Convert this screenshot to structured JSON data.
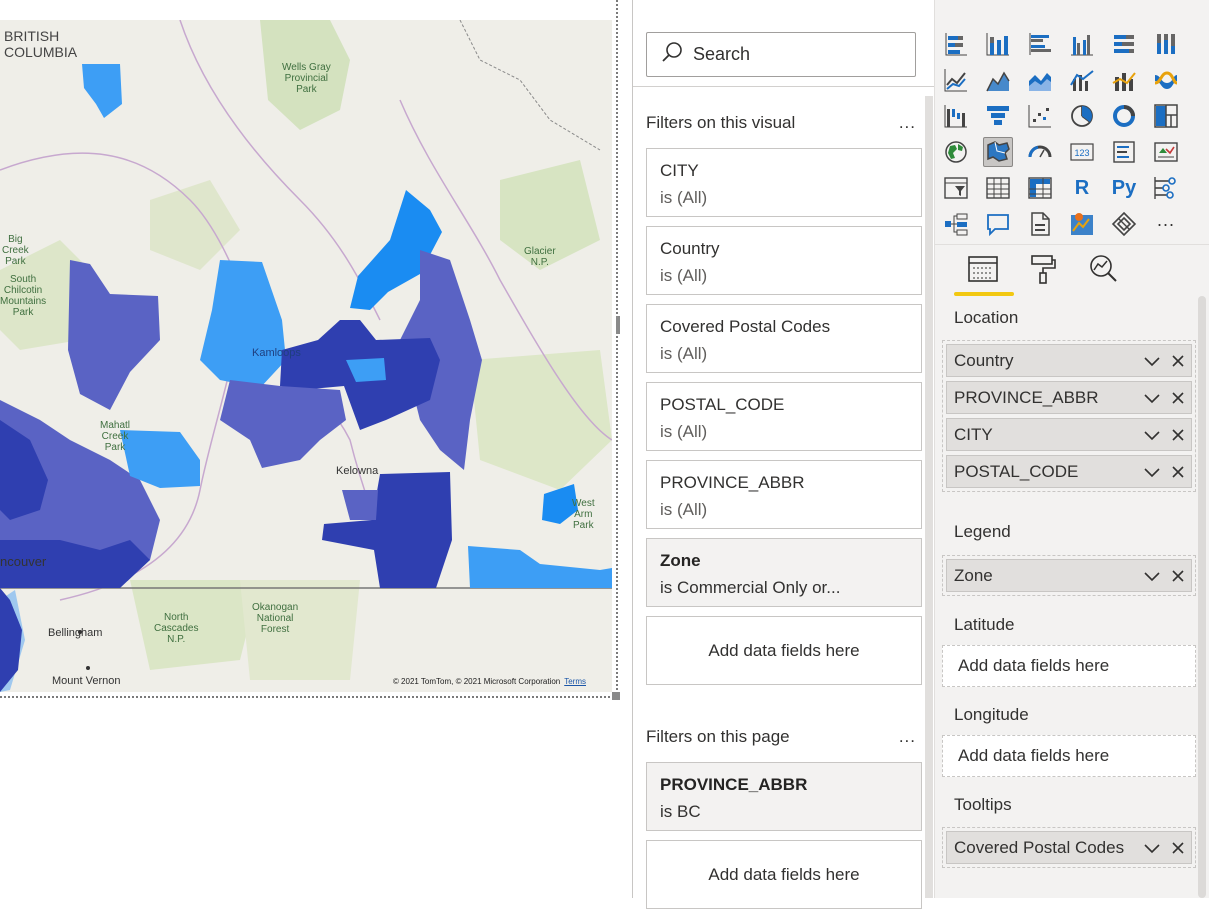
{
  "map": {
    "labels": {
      "province_line1": "BRITISH",
      "province_line2": "COLUMBIA",
      "wells_gray_1": "Wells Gray",
      "wells_gray_2": "Provincial",
      "wells_gray_3": "Park",
      "glacier_1": "Glacier",
      "glacier_2": "N.P.",
      "big_creek_1": "Big",
      "big_creek_2": "Creek",
      "big_creek_3": "Park",
      "south_chilcotin_1": "South",
      "south_chilcotin_2": "Chilcotin",
      "south_chilcotin_3": "Mountains",
      "south_chilcotin_4": "Park",
      "kamloops": "Kamloops",
      "mahatl_1": "Mahatl",
      "mahatl_2": "Creek",
      "mahatl_3": "Park",
      "kelowna": "Kelowna",
      "west_arm_1": "West",
      "west_arm_2": "Arm",
      "west_arm_3": "Park",
      "vancouver": "ncouver",
      "bellingham": "Bellingham",
      "north_cascades_1": "North",
      "north_cascades_2": "Cascades",
      "north_cascades_3": "N.P.",
      "okanogan_1": "Okanogan",
      "okanogan_2": "National",
      "okanogan_3": "Forest",
      "mount_vernon": "Mount Vernon"
    },
    "attribution": "© 2021 TomTom, © 2021 Microsoft Corporation",
    "terms": "Terms",
    "colors": {
      "dark": "#2f3fb0",
      "medium": "#5a63c4",
      "light": "#3d9ef5",
      "bright": "#1a8cf2"
    }
  },
  "filters": {
    "search_placeholder": "Search",
    "visual_section_title": "Filters on this visual",
    "more": "...",
    "visual_filters": [
      {
        "name": "CITY",
        "value": "is (All)"
      },
      {
        "name": "Country",
        "value": "is (All)"
      },
      {
        "name": "Covered Postal Codes",
        "value": "is (All)"
      },
      {
        "name": "POSTAL_CODE",
        "value": "is (All)"
      },
      {
        "name": "PROVINCE_ABBR",
        "value": "is (All)"
      },
      {
        "name": "Zone",
        "value": "is Commercial Only or..."
      }
    ],
    "add_fields": "Add data fields here",
    "page_section_title": "Filters on this page",
    "page_filters": [
      {
        "name": "PROVINCE_ABBR",
        "value": "is BC"
      }
    ]
  },
  "viz": {
    "icons": [
      "stacked-bar-icon",
      "stacked-column-icon",
      "clustered-bar-icon",
      "clustered-column-icon",
      "100-stacked-bar-icon",
      "100-stacked-column-icon",
      "line-chart-icon",
      "area-chart-icon",
      "stacked-area-icon",
      "line-clustered-column-icon",
      "line-stacked-column-icon",
      "ribbon-chart-icon",
      "waterfall-icon",
      "funnel-icon",
      "scatter-icon",
      "pie-chart-icon",
      "donut-chart-icon",
      "treemap-icon",
      "map-icon",
      "filled-map-icon",
      "gauge-icon",
      "card-icon",
      "multi-row-card-icon",
      "kpi-icon",
      "slicer-icon",
      "table-icon",
      "matrix-icon",
      "r-visual-icon",
      "python-visual-icon",
      "key-influencers-icon",
      "decomposition-tree-icon",
      "qa-icon",
      "paginated-report-icon",
      "arcgis-icon",
      "power-apps-icon",
      "more-visuals-icon"
    ],
    "r_label": "R",
    "py_label": "Py",
    "more_label": "...",
    "wells": {
      "location_title": "Location",
      "location_fields": [
        "Country",
        "PROVINCE_ABBR",
        "CITY",
        "POSTAL_CODE"
      ],
      "legend_title": "Legend",
      "legend_fields": [
        "Zone"
      ],
      "latitude_title": "Latitude",
      "longitude_title": "Longitude",
      "tooltips_title": "Tooltips",
      "tooltips_fields": [
        "Covered Postal Codes"
      ],
      "add_fields": "Add data fields here"
    },
    "accent": "#f2c811"
  }
}
